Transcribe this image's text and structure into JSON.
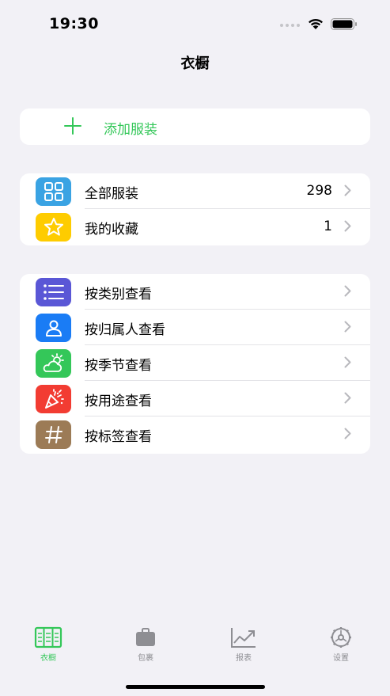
{
  "status_bar": {
    "time": "19:30",
    "wifi_icon": "wifi-icon",
    "battery_icon": "battery-icon"
  },
  "nav": {
    "title": "衣橱"
  },
  "add_item": {
    "label": "添加服装",
    "icon": "plus-icon",
    "color": "#34c759"
  },
  "group1": {
    "items": [
      {
        "label": "全部服装",
        "count": "298",
        "icon": "grid-icon",
        "color": "#3aa3e3"
      },
      {
        "label": "我的收藏",
        "count": "1",
        "icon": "star-icon",
        "color": "#fecc00"
      }
    ]
  },
  "group2": {
    "items": [
      {
        "label": "按类别查看",
        "icon": "list-icon",
        "color": "#5a57d6"
      },
      {
        "label": "按归属人查看",
        "icon": "person-icon",
        "color": "#1a7cf5"
      },
      {
        "label": "按季节查看",
        "icon": "weather-icon",
        "color": "#34c759"
      },
      {
        "label": "按用途查看",
        "icon": "party-popper-icon",
        "color": "#f23c32"
      },
      {
        "label": "按标签查看",
        "icon": "hashtag-icon",
        "color": "#9c7b56"
      }
    ]
  },
  "tabs": [
    {
      "label": "衣橱",
      "icon": "wardrobe-icon",
      "active": true
    },
    {
      "label": "包裹",
      "icon": "bag-icon",
      "active": false
    },
    {
      "label": "报表",
      "icon": "chart-icon",
      "active": false
    },
    {
      "label": "设置",
      "icon": "gear-icon",
      "active": false
    }
  ],
  "colors": {
    "accent": "#34c759",
    "background": "#f2f1f6",
    "inactive_tab": "#8e8e93"
  }
}
